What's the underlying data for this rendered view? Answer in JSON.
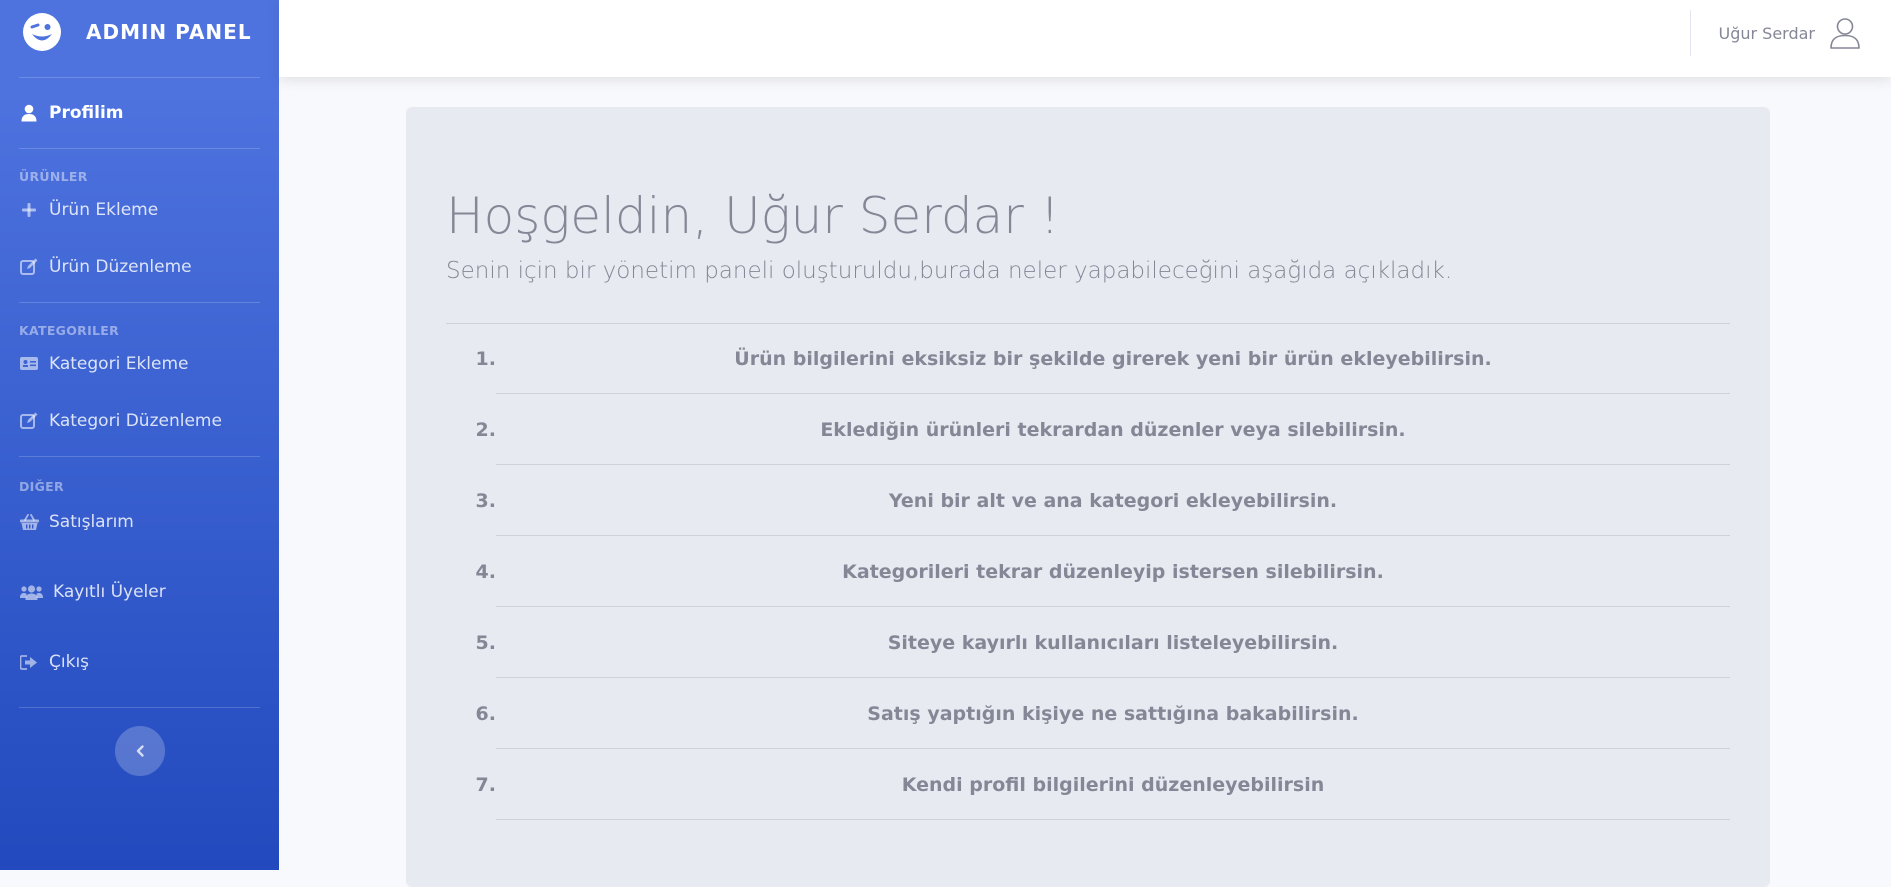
{
  "colors": {
    "sidebar_gradient_start": "#4e73df",
    "sidebar_gradient_end": "#224abe",
    "text_gray": "#858796",
    "content_bg": "#e8eaf1"
  },
  "brand": {
    "logo_icon": "winking-face-icon",
    "title": "ADMIN PANEL"
  },
  "sidebar": {
    "profile": {
      "icon": "user-icon",
      "label": "Profilim"
    },
    "sections": [
      {
        "heading": "ÜRÜNLER",
        "items": [
          {
            "icon": "plus-icon",
            "label": "Ürün Ekleme"
          },
          {
            "icon": "edit-icon",
            "label": "Ürün Düzenleme"
          }
        ]
      },
      {
        "heading": "KATEGORILER",
        "items": [
          {
            "icon": "id-card-icon",
            "label": "Kategori Ekleme"
          },
          {
            "icon": "edit-icon",
            "label": "Kategori Düzenleme"
          }
        ]
      },
      {
        "heading": "DIĞER",
        "items": [
          {
            "icon": "shopping-basket-icon",
            "label": "Satışlarım"
          },
          {
            "icon": "users-icon",
            "label": "Kayıtlı Üyeler"
          },
          {
            "icon": "sign-out-icon",
            "label": "Çıkış"
          }
        ]
      }
    ],
    "toggle_icon": "chevron-left-icon"
  },
  "topbar": {
    "user_name": "Uğur Serdar",
    "user_icon": "user-outline-icon"
  },
  "main": {
    "welcome_title": "Hoşgeldin, Uğur Serdar !",
    "lead": "Senin için bir yönetim paneli oluşturuldu,burada neler yapabileceğini aşağıda açıkladık.",
    "features": [
      {
        "num": "1.",
        "text": "Ürün bilgilerini eksiksiz bir şekilde girerek yeni bir ürün ekleyebilirsin."
      },
      {
        "num": "2.",
        "text": "Eklediğin ürünleri tekrardan düzenler veya silebilirsin."
      },
      {
        "num": "3.",
        "text": "Yeni bir alt ve ana kategori ekleyebilirsin."
      },
      {
        "num": "4.",
        "text": "Kategorileri tekrar düzenleyip istersen silebilirsin."
      },
      {
        "num": "5.",
        "text": "Siteye kayırlı kullanıcıları listeleyebilirsin."
      },
      {
        "num": "6.",
        "text": "Satış yaptığın kişiye ne sattığına bakabilirsin."
      },
      {
        "num": "7.",
        "text": "Kendi profil bilgilerini düzenleyebilirsin"
      }
    ]
  }
}
